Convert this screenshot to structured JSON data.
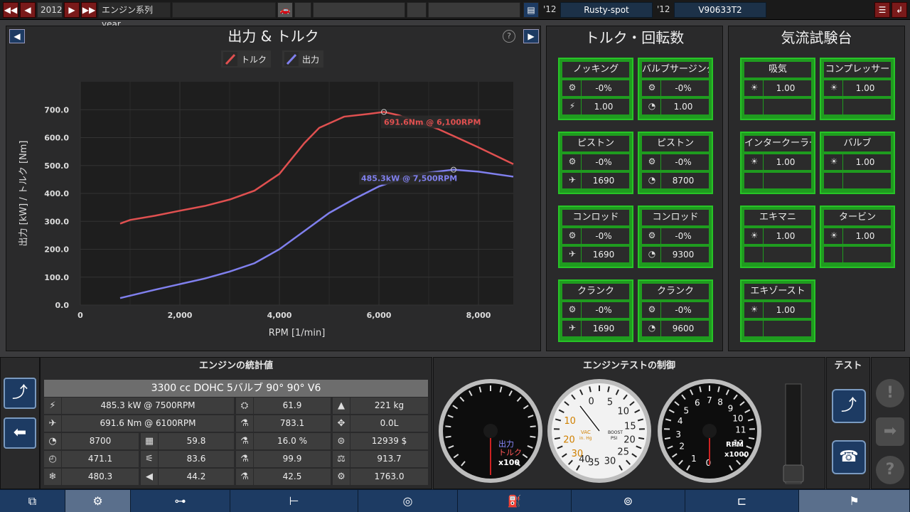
{
  "topbar": {
    "year": "2012",
    "year_label": "エンジン系列 year",
    "year2": "'12",
    "family_name": "Rusty-spot",
    "year3": "'12",
    "variant_name": "V90633T2"
  },
  "power_panel": {
    "title": "出力 & トルク",
    "help": "?",
    "legend_torque": "トルク",
    "legend_power": "出力",
    "torque_label": "691.6Nm @ 6,100RPM",
    "power_label": "485.3kW @ 7,500RPM"
  },
  "chart_data": {
    "type": "line",
    "xlabel": "RPM [1/min]",
    "ylabel": "出力 [kW] / トルク [Nm]",
    "xlim": [
      0,
      8700
    ],
    "ylim": [
      0,
      800
    ],
    "x_ticks": [
      "0",
      "2,000",
      "4,000",
      "6,000",
      "8,000"
    ],
    "y_ticks": [
      "0.0",
      "100.0",
      "200.0",
      "300.0",
      "400.0",
      "500.0",
      "600.0",
      "700.0"
    ],
    "grid": true,
    "legend": "top-center",
    "series": [
      {
        "name": "トルク",
        "color": "#e05050",
        "x": [
          800,
          1000,
          1500,
          2000,
          2500,
          3000,
          3500,
          4000,
          4500,
          4800,
          5300,
          5800,
          6100,
          6400,
          7200,
          8000,
          8700
        ],
        "y": [
          292,
          305,
          320,
          338,
          355,
          378,
          410,
          470,
          580,
          635,
          675,
          685,
          692,
          680,
          630,
          565,
          505
        ]
      },
      {
        "name": "出力",
        "color": "#8080ee",
        "x": [
          800,
          1500,
          2000,
          2500,
          3000,
          3500,
          4000,
          4500,
          5000,
          5500,
          6000,
          6500,
          7000,
          7500,
          8000,
          8700
        ],
        "y": [
          25,
          55,
          75,
          95,
          120,
          150,
          200,
          265,
          330,
          380,
          425,
          455,
          475,
          485,
          478,
          460
        ]
      }
    ]
  },
  "torque_rpm": {
    "title": "トルク・回転数",
    "cells": [
      {
        "title": "ノッキング",
        "v1": "-0%",
        "v2": "1.00",
        "i1": "⛭",
        "i2": "⚡"
      },
      {
        "title": "バルブサージング",
        "v1": "-0%",
        "v2": "1.00",
        "i1": "⛭",
        "i2": "◔"
      },
      {
        "title": "ピストン",
        "v1": "-0%",
        "v2": "1690",
        "i1": "⛭",
        "i2": "✈"
      },
      {
        "title": "ピストン",
        "v1": "-0%",
        "v2": "8700",
        "i1": "⛭",
        "i2": "◔"
      },
      {
        "title": "コンロッド",
        "v1": "-0%",
        "v2": "1690",
        "i1": "⛭",
        "i2": "✈"
      },
      {
        "title": "コンロッド",
        "v1": "-0%",
        "v2": "9300",
        "i1": "⛭",
        "i2": "◔"
      },
      {
        "title": "クランク",
        "v1": "-0%",
        "v2": "1690",
        "i1": "⛭",
        "i2": "✈"
      },
      {
        "title": "クランク",
        "v1": "-0%",
        "v2": "9600",
        "i1": "⛭",
        "i2": "◔"
      }
    ]
  },
  "airflow": {
    "title": "気流試験台",
    "cells": [
      {
        "title": "吸気",
        "v1": "1.00"
      },
      {
        "title": "コンプレッサー",
        "v1": "1.00"
      },
      {
        "title": "インタークーラー",
        "v1": "1.00"
      },
      {
        "title": "バルブ",
        "v1": "1.00"
      },
      {
        "title": "エキマニ",
        "v1": "1.00"
      },
      {
        "title": "タービン",
        "v1": "1.00"
      },
      {
        "title": "エキゾースト",
        "v1": "1.00"
      }
    ]
  },
  "stats": {
    "title": "エンジンの統計値",
    "engine_desc": "3300 cc DOHC 5バルブ 90° 90° V6",
    "rows": [
      {
        "a": "485.3 kW @ 7500RPM",
        "b": "61.9",
        "c": "221 kg"
      },
      {
        "a": "691.6 Nm @ 6100RPM",
        "b": "783.1",
        "c": "0.0L"
      },
      {
        "a": "8700",
        "a2": "59.8",
        "b": "16.0 %",
        "c": "12939 $"
      },
      {
        "a": "471.1",
        "a2": "83.6",
        "b": "99.9",
        "c": "913.7"
      },
      {
        "a": "480.3",
        "a2": "44.2",
        "b": "42.5",
        "c": "1763.0"
      }
    ]
  },
  "test_control": {
    "title": "エンジンテストの制御",
    "test_title": "テスト",
    "gauge1_label1": "出力",
    "gauge1_label2": "トルク",
    "gauge1_unit": "x100",
    "gauge2_vac": "VAC",
    "gauge2_vac_unit": "in. Hg",
    "gauge2_boost": "BOOST",
    "gauge2_boost_unit": "PSI",
    "gauge3_unit": "RPM",
    "gauge3_mult": "x1000"
  },
  "colors": {
    "accent": "#1d3b63",
    "ok_green": "#1f9c1f",
    "torque": "#e05050",
    "power": "#8080ee"
  }
}
